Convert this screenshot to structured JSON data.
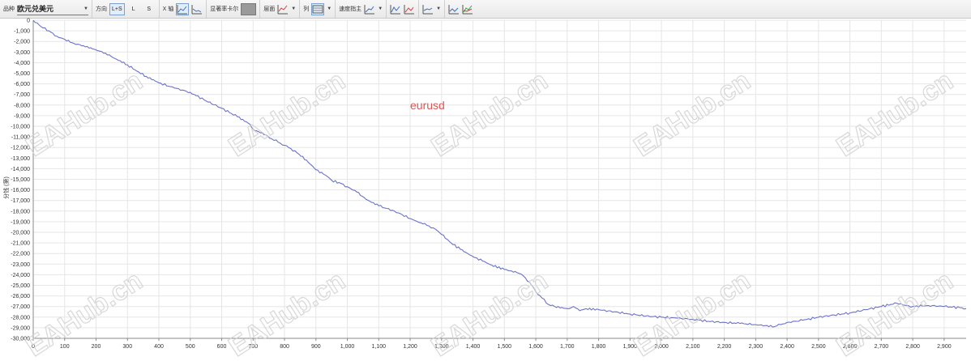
{
  "toolbar": {
    "symbol_label": "品种",
    "symbol_value": "欧元兑美元",
    "direction_label": "方向",
    "dir_both": "L+S",
    "dir_long": "L",
    "dir_short": "S",
    "xaxis_label": "X 轴",
    "crosshair_label": "显著率卡尔",
    "levels_label": "层面",
    "columns_label": "列",
    "speed_label": "速度指主"
  },
  "chart_data": {
    "type": "line",
    "title": "",
    "annotation": "eurusd",
    "ylabel": "分钱 (第)",
    "xlabel": "",
    "xlim": [
      0,
      2970
    ],
    "ylim": [
      -30000,
      0
    ],
    "xticks": [
      0,
      100,
      200,
      300,
      400,
      500,
      600,
      700,
      800,
      900,
      1000,
      1100,
      1200,
      1300,
      1400,
      1500,
      1600,
      1700,
      1800,
      1900,
      2000,
      2100,
      2200,
      2300,
      2400,
      2500,
      2600,
      2700,
      2800,
      2900
    ],
    "xtick_labels": [
      "0",
      "100",
      "200",
      "300",
      "400",
      "500",
      "600",
      "700",
      "800",
      "900",
      "1,000",
      "1,100",
      "1,200",
      "1,300",
      "1,400",
      "1,500",
      "1,600",
      "1,700",
      "1,800",
      "1,900",
      "2,000",
      "2,100",
      "2,200",
      "2,300",
      "2,400",
      "2,500",
      "2,600",
      "2,700",
      "2,800",
      "2,900"
    ],
    "yticks": [
      0,
      -1000,
      -2000,
      -3000,
      -4000,
      -5000,
      -6000,
      -7000,
      -8000,
      -9000,
      -10000,
      -11000,
      -12000,
      -13000,
      -14000,
      -15000,
      -16000,
      -17000,
      -18000,
      -19000,
      -20000,
      -21000,
      -22000,
      -23000,
      -24000,
      -25000,
      -26000,
      -27000,
      -28000,
      -29000,
      -30000
    ],
    "ytick_labels": [
      "0",
      "-1,000",
      "-2,000",
      "-3,000",
      "-4,000",
      "-5,000",
      "-6,000",
      "-7,000",
      "-8,000",
      "-9,000",
      "-10,000",
      "-11,000",
      "-12,000",
      "-13,000",
      "-14,000",
      "-15,000",
      "-16,000",
      "-17,000",
      "-18,000",
      "-19,000",
      "-20,000",
      "-21,000",
      "-22,000",
      "-23,000",
      "-24,000",
      "-25,000",
      "-26,000",
      "-27,000",
      "-28,000",
      "-29,000",
      "-30,000"
    ],
    "grid": true,
    "series": [
      {
        "color": "#6b73c8",
        "x": [
          0,
          25,
          50,
          75,
          100,
          130,
          160,
          200,
          230,
          260,
          300,
          330,
          360,
          400,
          450,
          500,
          550,
          600,
          650,
          690,
          700,
          740,
          760,
          780,
          800,
          820,
          840,
          870,
          900,
          930,
          950,
          980,
          1000,
          1030,
          1060,
          1100,
          1150,
          1200,
          1240,
          1260,
          1280,
          1300,
          1330,
          1360,
          1400,
          1430,
          1460,
          1500,
          1540,
          1560,
          1580,
          1600,
          1620,
          1640,
          1660,
          1700,
          1720,
          1740,
          1760,
          1800,
          1850,
          1900,
          1950,
          2000,
          2050,
          2100,
          2150,
          2200,
          2250,
          2300,
          2330,
          2360,
          2380,
          2400,
          2450,
          2500,
          2550,
          2600,
          2650,
          2700,
          2730,
          2750,
          2780,
          2800,
          2850,
          2900,
          2950,
          2970
        ],
        "y": [
          0,
          -600,
          -1000,
          -1500,
          -1800,
          -2200,
          -2400,
          -2800,
          -3100,
          -3600,
          -4200,
          -4800,
          -5300,
          -5900,
          -6400,
          -6800,
          -7600,
          -8300,
          -9100,
          -9800,
          -10300,
          -10800,
          -11200,
          -11500,
          -11800,
          -12100,
          -12500,
          -13200,
          -14100,
          -14600,
          -15100,
          -15400,
          -15700,
          -16200,
          -16900,
          -17500,
          -18000,
          -18700,
          -19200,
          -19400,
          -19700,
          -20200,
          -21000,
          -21600,
          -22300,
          -22700,
          -23100,
          -23500,
          -23800,
          -24100,
          -24700,
          -25600,
          -26200,
          -26800,
          -27000,
          -27200,
          -27000,
          -27400,
          -27200,
          -27300,
          -27500,
          -27700,
          -27900,
          -28000,
          -28100,
          -28200,
          -28400,
          -28500,
          -28600,
          -28700,
          -28800,
          -28900,
          -28700,
          -28500,
          -28300,
          -28000,
          -27800,
          -27600,
          -27300,
          -27000,
          -26800,
          -26700,
          -26900,
          -27000,
          -26900,
          -27000,
          -27100,
          -27200
        ]
      }
    ]
  },
  "watermark": {
    "text": "EAHub.cn"
  },
  "colors": {
    "line": "#6b73c8",
    "annotation": "#e05555",
    "grid": "#e6e6e6"
  }
}
